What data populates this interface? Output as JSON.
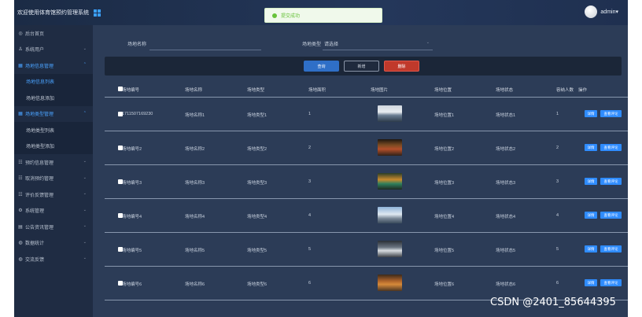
{
  "header": {
    "title": "欢迎使用体育馆预约管理系统",
    "user_label": "admin▾"
  },
  "toast": {
    "text": "提交成功"
  },
  "sidebar": {
    "items": [
      {
        "label": "后台首页",
        "icon": "dashboard-icon",
        "glyph": "◎",
        "expandable": false
      },
      {
        "label": "系统用户",
        "icon": "user-icon",
        "glyph": "♙",
        "expandable": true
      },
      {
        "label": "场地信息管理",
        "icon": "grid-icon",
        "glyph": "▦",
        "expandable": true,
        "active": true,
        "children": [
          {
            "label": "场地信息列表",
            "active": true
          },
          {
            "label": "场地信息添加"
          }
        ]
      },
      {
        "label": "场地类型管理",
        "icon": "grid-icon",
        "glyph": "▦",
        "expandable": true,
        "active": true,
        "children": [
          {
            "label": "场地类型列表"
          },
          {
            "label": "场地类型添加"
          }
        ]
      },
      {
        "label": "预约信息管理",
        "icon": "list-icon",
        "glyph": "☷",
        "expandable": true
      },
      {
        "label": "取消预约管理",
        "icon": "list-icon",
        "glyph": "☷",
        "expandable": true
      },
      {
        "label": "评价反馈管理",
        "icon": "list-icon",
        "glyph": "☷",
        "expandable": true
      },
      {
        "label": "系统管理",
        "icon": "gear-icon",
        "glyph": "⚙",
        "expandable": true
      },
      {
        "label": "公告资讯管理",
        "icon": "doc-icon",
        "glyph": "▤",
        "expandable": true
      },
      {
        "label": "数据统计",
        "icon": "chart-icon",
        "glyph": "◍",
        "expandable": true
      },
      {
        "label": "交流反馈",
        "icon": "chat-icon",
        "glyph": "◍",
        "expandable": true
      }
    ]
  },
  "search": {
    "name_label": "场地名称",
    "type_label": "场地类型",
    "type_value": "请选择"
  },
  "buttons": {
    "query": "查询",
    "add": "新增",
    "delete": "删除"
  },
  "table": {
    "headers": [
      "场地编号",
      "场地名称",
      "场地类型",
      "场地面积",
      "场地图片",
      "场地位置",
      "场地状态",
      "容纳人数",
      "操作"
    ],
    "rows": [
      [
        "1711507169230",
        "场地名称1",
        "场地类型1",
        "1",
        "",
        "场地位置1",
        "场地状态1",
        "1"
      ],
      [
        "场地编号2",
        "场地名称2",
        "场地类型2",
        "2",
        "",
        "场地位置2",
        "场地状态2",
        "2"
      ],
      [
        "场地编号3",
        "场地名称3",
        "场地类型3",
        "3",
        "",
        "场地位置3",
        "场地状态3",
        "3"
      ],
      [
        "场地编号4",
        "场地名称4",
        "场地类型4",
        "4",
        "",
        "场地位置4",
        "场地状态4",
        "4"
      ],
      [
        "场地编号5",
        "场地名称5",
        "场地类型5",
        "5",
        "",
        "场地位置5",
        "场地状态5",
        "5"
      ],
      [
        "场地编号6",
        "场地名称6",
        "场地类型6",
        "6",
        "",
        "场地位置6",
        "场地状态6",
        "6"
      ]
    ],
    "actions": {
      "detail": "详情",
      "view": "查看评论"
    }
  },
  "watermark": "CSDN @2401_85644395",
  "colors": {
    "accent": "#2f8cff",
    "danger": "#c0392b",
    "success": "#67c23a",
    "sidebar_bg": "#1f2c43",
    "main_bg": "#2c3c57"
  }
}
